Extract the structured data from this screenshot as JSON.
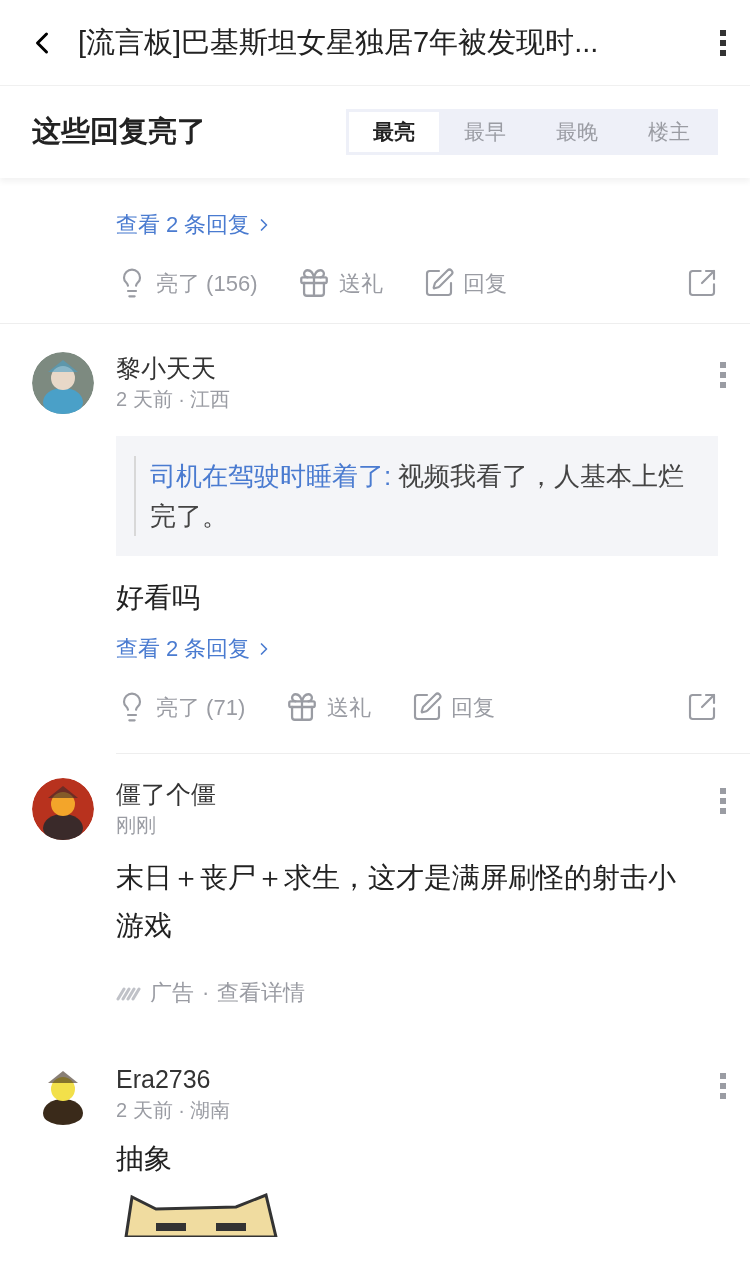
{
  "header": {
    "title": "[流言板]巴基斯坦女星独居7年被发现时..."
  },
  "sort_bar": {
    "title": "这些回复亮了",
    "tabs": [
      {
        "label": "最亮",
        "selected": true
      },
      {
        "label": "最早",
        "selected": false
      },
      {
        "label": "最晚",
        "selected": false
      },
      {
        "label": "楼主",
        "selected": false
      }
    ]
  },
  "comments": [
    {
      "kind": "partial",
      "replies_link": "查看 2 条回复",
      "actions": {
        "light": "亮了 (156)",
        "gift": "送礼",
        "reply": "回复"
      }
    },
    {
      "kind": "reply",
      "author": "黎小天天",
      "meta": "2 天前 · 江西",
      "quote": {
        "author": "司机在驾驶时睡着了:",
        "text": "视频我看了，人基本上烂完了。"
      },
      "text": "好看吗",
      "replies_link": "查看 2 条回复",
      "actions": {
        "light": "亮了 (71)",
        "gift": "送礼",
        "reply": "回复"
      }
    },
    {
      "kind": "ad",
      "author": "僵了个僵",
      "meta": "刚刚",
      "text": "末日＋丧尸＋求生，这才是满屏刷怪的射击小游戏",
      "ad_label": "广告",
      "ad_separator": "·",
      "ad_link": "查看详情"
    },
    {
      "author": "Era2736",
      "meta": "2 天前 · 湖南",
      "text": "抽象"
    }
  ]
}
